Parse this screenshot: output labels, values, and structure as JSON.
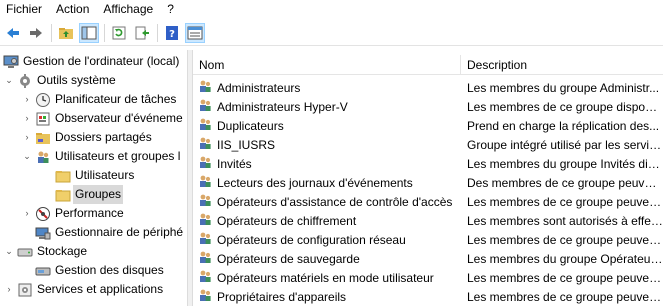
{
  "menu": [
    "Fichier",
    "Action",
    "Affichage",
    "?"
  ],
  "toolbar": {
    "icons": [
      "back-arrow-icon",
      "forward-arrow-icon",
      "up-folder-icon",
      "show-hide-tree-icon",
      "refresh-icon",
      "export-list-icon",
      "help-icon",
      "properties-icon"
    ]
  },
  "tree": [
    {
      "label": "Gestion de l'ordinateur (local)",
      "icon": "computer-management-icon",
      "arrow": ""
    },
    {
      "label": "Outils système",
      "icon": "system-tools-icon",
      "arrow": "⌄"
    },
    {
      "label": "Planificateur de tâches",
      "icon": "clock-icon",
      "arrow": "›"
    },
    {
      "label": "Observateur d'événeme",
      "icon": "event-viewer-icon",
      "arrow": "›"
    },
    {
      "label": "Dossiers partagés",
      "icon": "shared-folders-icon",
      "arrow": "›"
    },
    {
      "label": "Utilisateurs et groupes l",
      "icon": "users-groups-icon",
      "arrow": "⌄"
    },
    {
      "label": "Utilisateurs",
      "icon": "folder-icon",
      "arrow": ""
    },
    {
      "label": "Groupes",
      "icon": "folder-icon",
      "arrow": ""
    },
    {
      "label": "Performance",
      "icon": "performance-icon",
      "arrow": "›"
    },
    {
      "label": "Gestionnaire de périphé",
      "icon": "device-manager-icon",
      "arrow": ""
    },
    {
      "label": "Stockage",
      "icon": "storage-icon",
      "arrow": "⌄"
    },
    {
      "label": "Gestion des disques",
      "icon": "disk-management-icon",
      "arrow": ""
    },
    {
      "label": "Services et applications",
      "icon": "services-icon",
      "arrow": "›"
    }
  ],
  "columns": {
    "name": "Nom",
    "description": "Description"
  },
  "groups": [
    {
      "name": "Administrateurs",
      "description": "Les membres du groupe Administr..."
    },
    {
      "name": "Administrateurs Hyper-V",
      "description": "Les membres de ce groupe dispose..."
    },
    {
      "name": "Duplicateurs",
      "description": "Prend en charge la réplication des..."
    },
    {
      "name": "IIS_IUSRS",
      "description": "Groupe intégré utilisé par les servic..."
    },
    {
      "name": "Invités",
      "description": "Les membres du groupe Invités dis..."
    },
    {
      "name": "Lecteurs des journaux d'événements",
      "description": "Des membres de ce groupe peuven..."
    },
    {
      "name": "Opérateurs d'assistance de contrôle d'accès",
      "description": "Les membres de ce groupe peuven..."
    },
    {
      "name": "Opérateurs de chiffrement",
      "description": "Les membres sont autorisés à effec..."
    },
    {
      "name": "Opérateurs de configuration réseau",
      "description": "Les membres de ce groupe peuven..."
    },
    {
      "name": "Opérateurs de sauvegarde",
      "description": "Les membres du groupe Opérateur..."
    },
    {
      "name": "Opérateurs matériels en mode utilisateur",
      "description": "Les membres de ce groupe peuven..."
    },
    {
      "name": "Propriétaires d'appareils",
      "description": "Les membres de ce groupe peuven..."
    }
  ]
}
